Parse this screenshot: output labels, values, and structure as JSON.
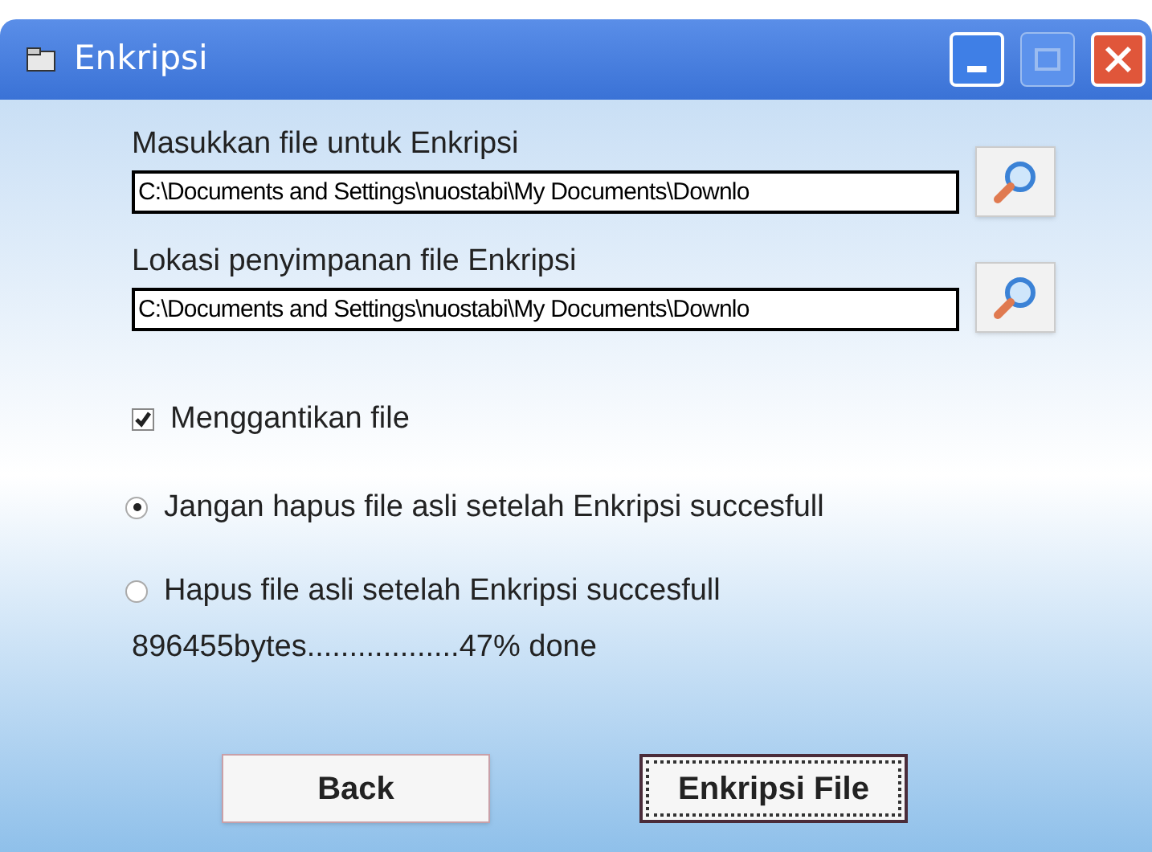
{
  "window": {
    "title": "Enkripsi"
  },
  "source": {
    "label": "Masukkan file untuk Enkripsi",
    "value": "C:\\Documents and Settings\\nuostabi\\My Documents\\Downlo"
  },
  "destination": {
    "label": "Lokasi penyimpanan file Enkripsi",
    "value": "C:\\Documents and Settings\\nuostabi\\My Documents\\Downlo"
  },
  "replace_file": {
    "label": "Menggantikan file",
    "checked": true
  },
  "options": [
    {
      "label": "Jangan hapus file asli setelah Enkripsi succesfull",
      "selected": true
    },
    {
      "label": "Hapus file asli setelah Enkripsi succesfull",
      "selected": false
    }
  ],
  "progress_text": "896455bytes..................47% done",
  "buttons": [
    {
      "label": "Back",
      "focused": false
    },
    {
      "label": "Enkripsi File",
      "focused": true
    }
  ]
}
